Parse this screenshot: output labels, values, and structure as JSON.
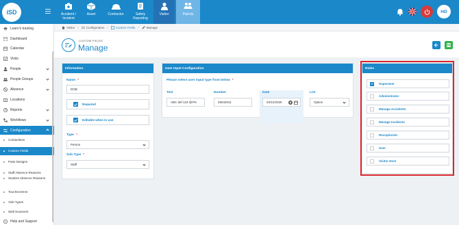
{
  "brand": {
    "logo_text": "iSD"
  },
  "topnav": {
    "modules": [
      {
        "label": "Accident / Incident",
        "icon": "accident-icon"
      },
      {
        "label": "Asset",
        "icon": "asset-icon"
      },
      {
        "label": "Contractor",
        "icon": "contractor-icon"
      },
      {
        "label": "Safety Reporting",
        "icon": "safety-icon"
      },
      {
        "label": "Visitor",
        "icon": "visitor-icon"
      },
      {
        "label": "Patrols",
        "icon": "patrols-icon"
      }
    ],
    "avatar_initials": "HD"
  },
  "sidebar": {
    "items": [
      {
        "label": "Learn's training"
      },
      {
        "label": "Dashboard"
      },
      {
        "label": "Calendar"
      },
      {
        "label": "Visits"
      },
      {
        "label": "People"
      },
      {
        "label": "People Groups"
      },
      {
        "label": "Absence"
      },
      {
        "label": "Locations"
      },
      {
        "label": "Reports"
      },
      {
        "label": "Workflows"
      },
      {
        "label": "Configuration"
      }
    ],
    "sub_items": [
      {
        "label": "Contactless"
      },
      {
        "label": "Custom Fields"
      },
      {
        "label": "Pass Designs"
      },
      {
        "label": "Staff Absence Reasons"
      },
      {
        "label": "Student Absence Reasons"
      },
      {
        "label": "Touchscreens"
      },
      {
        "label": "Visit Types"
      },
      {
        "label": "Wall Scanners"
      }
    ],
    "footer": {
      "label": "Help and Support"
    }
  },
  "breadcrumb": [
    "Visitor",
    "Configuration",
    "Custom Fields",
    "Manage"
  ],
  "header": {
    "small_title": "CUSTOM FIELDS",
    "title": "Manage"
  },
  "information": {
    "title": "Information",
    "name_label": "Name",
    "name_value": "DOB",
    "required_label": "Required",
    "editable_label": "Editable when in use",
    "type_label": "Type",
    "type_value": "Person",
    "subtype_label": "Sub Type",
    "subtype_value": "Staff"
  },
  "user_input": {
    "title": "User Input Configuration",
    "prompt": "Please select user input type from below",
    "options": [
      {
        "label": "Text",
        "value": "ABC def 123 @#%"
      },
      {
        "label": "Number",
        "value": "25042011"
      },
      {
        "label": "Date",
        "value": "04/12/2025"
      },
      {
        "label": "List",
        "value": "Option"
      }
    ]
  },
  "roles": {
    "title": "Roles",
    "items": [
      {
        "label": "SuperUser",
        "checked": true
      },
      {
        "label": "Administrator",
        "checked": false
      },
      {
        "label": "Manage Accidents",
        "checked": false
      },
      {
        "label": "Manage Incidents",
        "checked": false
      },
      {
        "label": "Receptionist",
        "checked": false
      },
      {
        "label": "User",
        "checked": false
      },
      {
        "label": "Visitor Host",
        "checked": false
      }
    ]
  },
  "colors": {
    "primary": "#1a88c9",
    "save": "#2fb34a",
    "highlight_border": "#d9262c"
  }
}
